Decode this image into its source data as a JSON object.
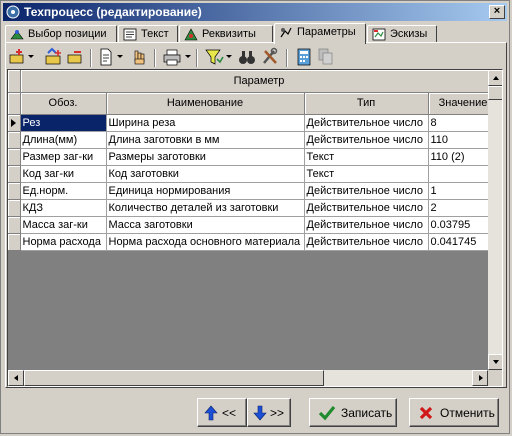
{
  "window": {
    "title": "Техпроцесс (редактирование)",
    "close": "×"
  },
  "tabs": [
    {
      "label": "Выбор позиции",
      "icon": "positions-icon"
    },
    {
      "label": "Текст",
      "icon": "text-icon"
    },
    {
      "label": "Реквизиты",
      "icon": "requisites-icon"
    },
    {
      "label": "Параметры",
      "icon": "parameters-icon",
      "active": true
    },
    {
      "label": "Эскизы",
      "icon": "sketches-icon"
    }
  ],
  "grid": {
    "group_header": "Параметр",
    "columns": [
      "Обоз.",
      "Наименование",
      "Тип",
      "Значение"
    ],
    "rows": [
      {
        "code": "Рез",
        "name": "Ширина реза",
        "type": "Действительное число",
        "value": "8"
      },
      {
        "code": "Длина(мм)",
        "name": "Длина заготовки в мм",
        "type": "Действительное число",
        "value": "110"
      },
      {
        "code": "Размер заг-ки",
        "name": "Размеры заготовки",
        "type": "Текст",
        "value": "110 (2)"
      },
      {
        "code": "Код заг-ки",
        "name": "Код заготовки",
        "type": "Текст",
        "value": ""
      },
      {
        "code": "Ед.норм.",
        "name": "Единица нормирования",
        "type": "Действительное число",
        "value": "1"
      },
      {
        "code": "КДЗ",
        "name": "Количество деталей из заготовки",
        "type": "Действительное число",
        "value": "2"
      },
      {
        "code": "Масса заг-ки",
        "name": "Масса заготовки",
        "type": "Действительное число",
        "value": "0.03795"
      },
      {
        "code": "Норма расхода",
        "name": "Норма расхода основного материала",
        "type": "Действительное число",
        "value": "0.041745"
      }
    ]
  },
  "buttons": {
    "prev": "<<",
    "next": ">>",
    "save": "Записать",
    "cancel": "Отменить"
  },
  "colors": {
    "titlebar": "#0a246a",
    "selection": "#0a246a",
    "face": "#d4d0c8"
  }
}
